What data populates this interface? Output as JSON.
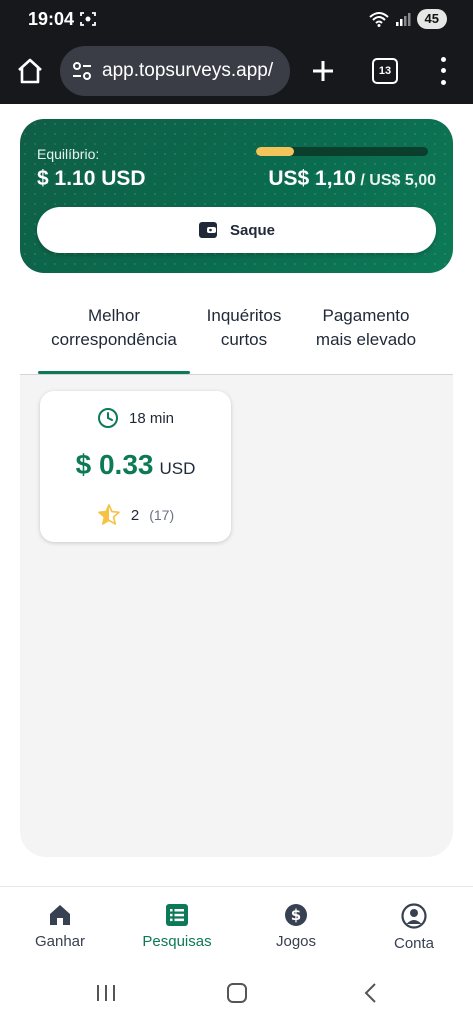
{
  "status_bar": {
    "time": "19:04",
    "battery": "45",
    "icons": [
      "screen-record-icon",
      "wifi-icon",
      "signal-icon",
      "battery-icon"
    ]
  },
  "browser": {
    "url": "app.topsurveys.app/",
    "tab_count": "13",
    "icons": [
      "home-icon",
      "site-settings-icon",
      "new-tab-icon",
      "tabs-icon",
      "overflow-menu-icon"
    ]
  },
  "balance": {
    "label": "Equilíbrio:",
    "value": "$ 1.10 USD",
    "progress_current": "US$ 1,10",
    "progress_separator": "/",
    "progress_target": "US$ 5,00",
    "progress_fraction": 0.22,
    "withdraw_label": "Saque",
    "colors": {
      "card": "#0a6b4e",
      "progress_fill": "#f3c35c",
      "progress_track": "#0b3e2d"
    }
  },
  "tabs": [
    {
      "line1": "Melhor",
      "line2": "correspondência",
      "active": true
    },
    {
      "line1": "Inquéritos",
      "line2": "curtos",
      "active": false
    },
    {
      "line1": "Pagamento",
      "line2": "mais elevado",
      "active": false
    }
  ],
  "surveys": [
    {
      "duration": "18 min",
      "amount": "$ 0.33",
      "currency": "USD",
      "rating": "2",
      "reviews": "(17)",
      "rating_fraction": 0.5
    }
  ],
  "bottom_nav": [
    {
      "label": "Ganhar",
      "icon": "home-icon",
      "active": false
    },
    {
      "label": "Pesquisas",
      "icon": "list-icon",
      "active": true
    },
    {
      "label": "Jogos",
      "icon": "dollar-coin-icon",
      "active": false
    },
    {
      "label": "Conta",
      "icon": "user-circle-icon",
      "active": false
    }
  ],
  "accent_color": "#0d7a57"
}
